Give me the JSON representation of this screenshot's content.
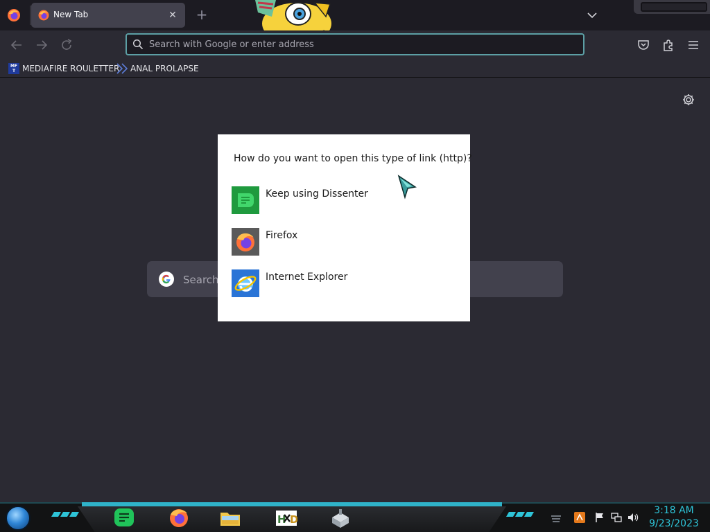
{
  "browser": {
    "tab": {
      "title": "New Tab",
      "close_glyph": "✕"
    },
    "new_tab_glyph": "+",
    "address_placeholder": "Search with Google or enter address",
    "bookmarks": [
      {
        "label": "MEDIAFIRE ROULETTER",
        "icon": "mediafire-icon",
        "icon_text": "MF\nT"
      },
      {
        "label": "ANAL PROLAPSE",
        "icon": "bookmark-icon"
      }
    ],
    "page_search_placeholder": "Search"
  },
  "dialog": {
    "question": "How do you want to open this type of link (http)?",
    "options": [
      {
        "label": "Keep using Dissenter",
        "icon": "dissenter-icon",
        "color": "#1f9a3e"
      },
      {
        "label": "Firefox",
        "icon": "firefox-icon",
        "color": "#5a5a5a"
      },
      {
        "label": "Internet Explorer",
        "icon": "internet-explorer-icon",
        "color": "#2a74d6"
      }
    ]
  },
  "taskbar": {
    "apps": [
      {
        "name": "dissenter-icon"
      },
      {
        "name": "firefox-icon"
      },
      {
        "name": "file-explorer-icon"
      },
      {
        "name": "hxd-icon"
      },
      {
        "name": "storage-icon"
      }
    ],
    "clock": {
      "time": "3:18 AM",
      "date": "9/23/2023"
    }
  },
  "colors": {
    "accent": "#2ec4d8",
    "toolbar": "#2b2a33",
    "tabstrip": "#1c1b22",
    "urlbar_border": "#5c9fa5"
  }
}
